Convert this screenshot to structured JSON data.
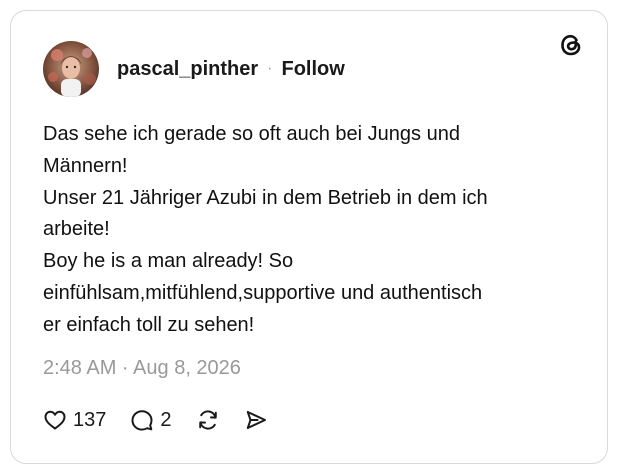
{
  "post": {
    "username": "pascal_pinther",
    "separator": "·",
    "follow_label": "Follow",
    "text_lines": [
      "Das sehe ich gerade so oft auch bei Jungs und",
      "Männern!",
      "Unser 21 Jähriger Azubi in dem Betrieb in dem ich",
      "arbeite!",
      "Boy he is a man already! So",
      "einfühlsam,mitfühlend,supportive und authentisch",
      "er einfach toll zu sehen!"
    ],
    "timestamp": "2:48 AM · Aug 8, 2026",
    "likes": "137",
    "replies": "2"
  },
  "icons": {
    "logo": "threads-logo-icon",
    "like": "heart-icon",
    "reply": "speech-bubble-icon",
    "repost": "repost-icon",
    "share": "send-icon"
  },
  "colors": {
    "text": "#1a1a1a",
    "muted": "#999999",
    "border": "#d9d9d9",
    "background": "#ffffff"
  }
}
